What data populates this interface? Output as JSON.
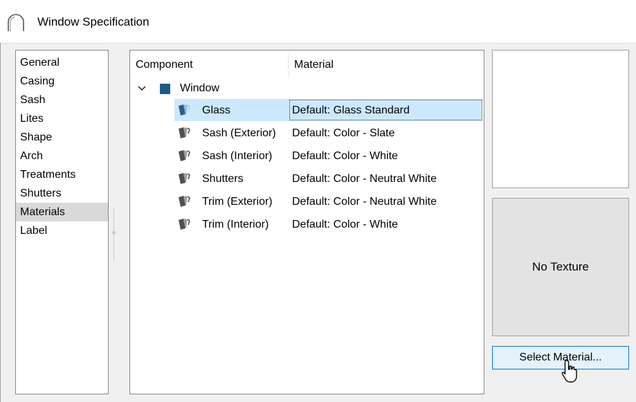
{
  "window": {
    "title": "Window Specification",
    "icon": "arch-icon"
  },
  "nav": {
    "items": [
      "General",
      "Casing",
      "Sash",
      "Lites",
      "Shape",
      "Arch",
      "Treatments",
      "Shutters",
      "Materials",
      "Label"
    ],
    "selected": "Materials"
  },
  "tree": {
    "columns": {
      "component": "Component",
      "material": "Material"
    },
    "root": {
      "label": "Window",
      "icon": "square-icon",
      "expanded": true
    },
    "rows": [
      {
        "component": "Glass",
        "material": "Default: Glass  Standard",
        "selected": true
      },
      {
        "component": "Sash (Exterior)",
        "material": "Default: Color - Slate"
      },
      {
        "component": "Sash (Interior)",
        "material": "Default: Color - White"
      },
      {
        "component": "Shutters",
        "material": "Default: Color - Neutral White"
      },
      {
        "component": "Trim (Exterior)",
        "material": "Default: Color - Neutral White"
      },
      {
        "component": "Trim (Interior)",
        "material": "Default: Color - White"
      }
    ]
  },
  "preview": {
    "texture_label": "No Texture"
  },
  "buttons": {
    "select_material": "Select Material..."
  },
  "colors": {
    "selection": "#cce8ff",
    "accent": "#0078d7",
    "root_icon": "#1d5b86"
  }
}
